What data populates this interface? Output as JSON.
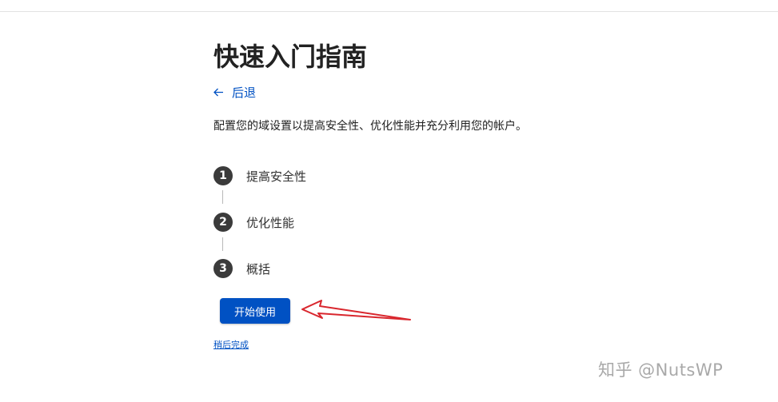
{
  "page": {
    "title": "快速入门指南",
    "back_label": "后退",
    "description": "配置您的域设置以提高安全性、优化性能并充分利用您的帐户。"
  },
  "steps": [
    {
      "number": "1",
      "label": "提高安全性"
    },
    {
      "number": "2",
      "label": "优化性能"
    },
    {
      "number": "3",
      "label": "概括"
    }
  ],
  "actions": {
    "start_label": "开始使用",
    "later_label": "稍后完成"
  },
  "watermark": "知乎 @NutsWP",
  "colors": {
    "accent": "#0051c3",
    "step_circle": "#3b3b3b",
    "annotation": "#d9272e"
  },
  "icons": {
    "back": "arrow-left-icon",
    "annotation": "red-arrow-icon"
  }
}
